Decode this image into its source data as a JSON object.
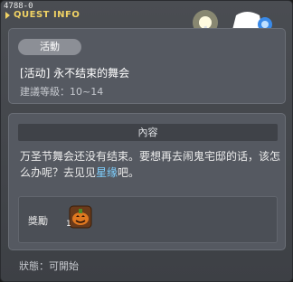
{
  "window": {
    "id_label": "4788-0",
    "title": "QUEST INFO"
  },
  "quest": {
    "category": "活動",
    "name": "[活动] 永不结束的舞会",
    "level_label": "建議等級：",
    "level_range": "10~14"
  },
  "content": {
    "header": "內容",
    "text_before": "万圣节舞会还没有结束。要想再去闹鬼宅邸的话，该怎么办呢？去见见",
    "npc_name": "星缘",
    "text_after": "吧。"
  },
  "reward": {
    "label": "獎勵",
    "item_icon": "pumpkin-box-icon",
    "item_count": "1"
  },
  "status": {
    "text": "狀態：可開始"
  },
  "npc": {
    "icon": "npc-portrait-witch-icon"
  },
  "colors": {
    "title": "#f0d264",
    "npc_link": "#7fd0ff",
    "panel_bg": "#555961",
    "window_bg": "#45484e"
  }
}
